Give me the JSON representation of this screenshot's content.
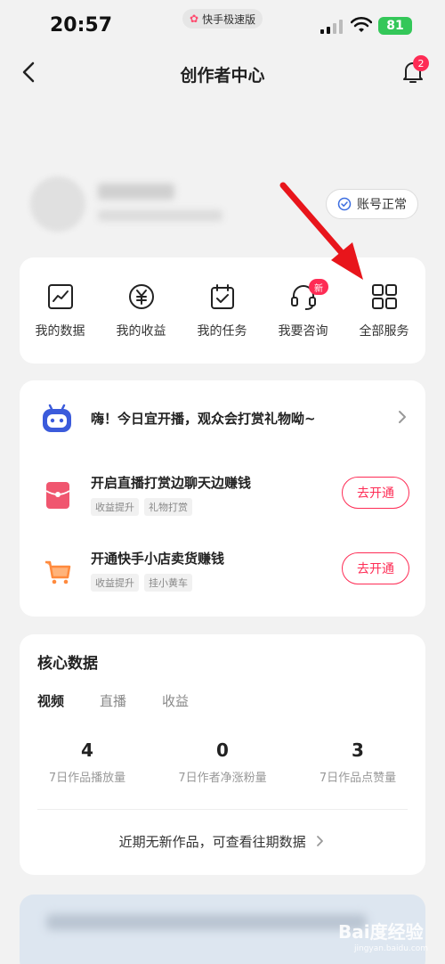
{
  "status_bar": {
    "time": "20:57",
    "app_pill": "快手极速版",
    "battery": "81"
  },
  "nav": {
    "title": "创作者中心",
    "notification_count": "2"
  },
  "profile": {
    "account_status": "账号正常"
  },
  "services": [
    {
      "label": "我的数据",
      "icon": "chart-icon"
    },
    {
      "label": "我的收益",
      "icon": "yuan-icon"
    },
    {
      "label": "我的任务",
      "icon": "calendar-check-icon"
    },
    {
      "label": "我要咨询",
      "icon": "headset-icon",
      "badge": "新"
    },
    {
      "label": "全部服务",
      "icon": "grid-icon"
    }
  ],
  "banner": {
    "text": "嗨！今日宜开播，观众会打赏礼物呦~"
  },
  "tasks": [
    {
      "title": "开启直播打赏边聊天边赚钱",
      "tags": [
        "收益提升",
        "礼物打赏"
      ],
      "button": "去开通",
      "icon": "red-envelope-icon"
    },
    {
      "title": "开通快手小店卖货赚钱",
      "tags": [
        "收益提升",
        "挂小黄车"
      ],
      "button": "去开通",
      "icon": "shopping-cart-icon"
    }
  ],
  "core": {
    "title": "核心数据",
    "tabs": [
      "视频",
      "直播",
      "收益"
    ],
    "active_tab": "视频",
    "metrics": [
      {
        "value": "4",
        "label": "7日作品播放量"
      },
      {
        "value": "0",
        "label": "7日作者净涨粉量"
      },
      {
        "value": "3",
        "label": "7日作品点赞量"
      }
    ],
    "footer": "近期无新作品，可查看往期数据"
  },
  "watermark": {
    "brand": "Bai度经验",
    "url": "jingyan.baidu.com"
  },
  "colors": {
    "accent": "#fe2c55",
    "background": "#f2f2f2",
    "battery": "#34c759"
  }
}
